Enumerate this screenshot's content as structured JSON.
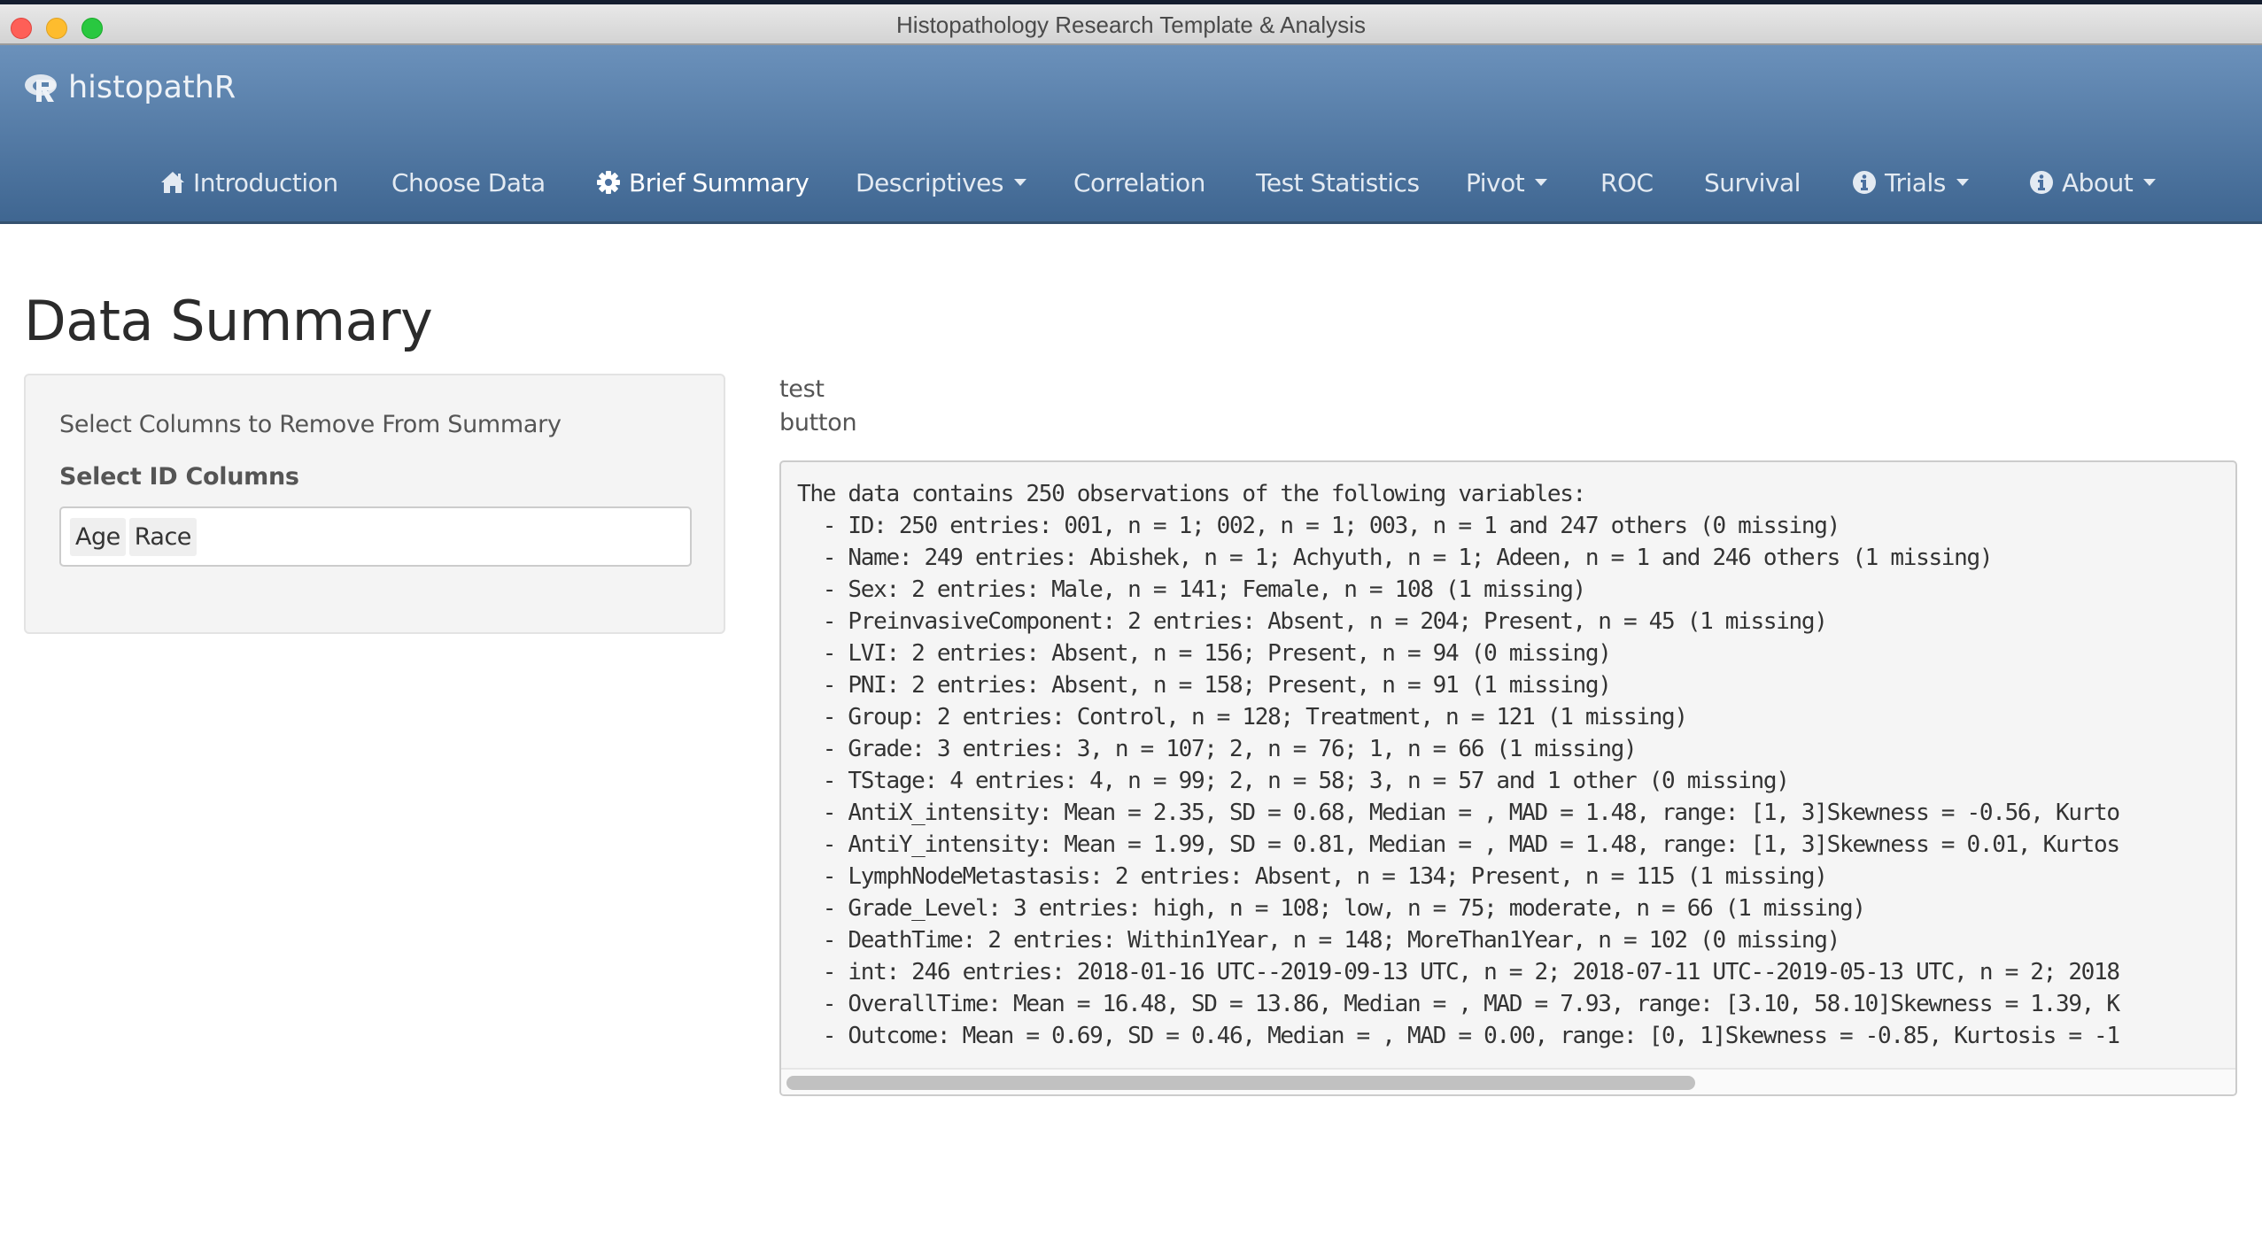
{
  "window": {
    "title": "Histopathology Research Template & Analysis",
    "controls": [
      "close",
      "minimize",
      "zoom"
    ]
  },
  "navbar": {
    "brand": {
      "icon": "r-logo-icon",
      "label": "histopathR"
    },
    "items": [
      {
        "label": "Introduction",
        "icon": "home-icon",
        "dropdown": false,
        "active": false
      },
      {
        "label": "Choose Data",
        "icon": null,
        "dropdown": false,
        "active": false
      },
      {
        "label": "Brief Summary",
        "icon": "gear-icon",
        "dropdown": false,
        "active": true
      },
      {
        "label": "Descriptives",
        "icon": null,
        "dropdown": true,
        "active": false
      },
      {
        "label": "Correlation",
        "icon": null,
        "dropdown": false,
        "active": false
      },
      {
        "label": "Test Statistics",
        "icon": null,
        "dropdown": false,
        "active": false
      },
      {
        "label": "Pivot",
        "icon": null,
        "dropdown": true,
        "active": false
      },
      {
        "label": "ROC",
        "icon": null,
        "dropdown": false,
        "active": false
      },
      {
        "label": "Survival",
        "icon": null,
        "dropdown": false,
        "active": false
      },
      {
        "label": "Trials",
        "icon": "info-circle-icon",
        "dropdown": true,
        "active": false
      },
      {
        "label": "About",
        "icon": "info-circle-icon",
        "dropdown": true,
        "active": false
      }
    ]
  },
  "page": {
    "title": "Data Summary"
  },
  "sidebar": {
    "section_label": "Select Columns to Remove From Summary",
    "id_columns": {
      "label": "Select ID Columns",
      "selected": [
        "Age",
        "Race"
      ]
    }
  },
  "main": {
    "text_lines": [
      "test",
      "button"
    ],
    "summary": {
      "lines": [
        "The data contains 250 observations of the following variables:",
        "  - ID: 250 entries: 001, n = 1; 002, n = 1; 003, n = 1 and 247 others (0 missing)",
        "  - Name: 249 entries: Abishek, n = 1; Achyuth, n = 1; Adeen, n = 1 and 246 others (1 missing)",
        "  - Sex: 2 entries: Male, n = 141; Female, n = 108 (1 missing)",
        "  - PreinvasiveComponent: 2 entries: Absent, n = 204; Present, n = 45 (1 missing)",
        "  - LVI: 2 entries: Absent, n = 156; Present, n = 94 (0 missing)",
        "  - PNI: 2 entries: Absent, n = 158; Present, n = 91 (1 missing)",
        "  - Group: 2 entries: Control, n = 128; Treatment, n = 121 (1 missing)",
        "  - Grade: 3 entries: 3, n = 107; 2, n = 76; 1, n = 66 (1 missing)",
        "  - TStage: 4 entries: 4, n = 99; 2, n = 58; 3, n = 57 and 1 other (0 missing)",
        "  - AntiX_intensity: Mean = 2.35, SD = 0.68, Median = , MAD = 1.48, range: [1, 3]Skewness = -0.56, Kurto",
        "  - AntiY_intensity: Mean = 1.99, SD = 0.81, Median = , MAD = 1.48, range: [1, 3]Skewness = 0.01, Kurtos",
        "  - LymphNodeMetastasis: 2 entries: Absent, n = 134; Present, n = 115 (1 missing)",
        "  - Grade_Level: 3 entries: high, n = 108; low, n = 75; moderate, n = 66 (1 missing)",
        "  - DeathTime: 2 entries: Within1Year, n = 148; MoreThan1Year, n = 102 (0 missing)",
        "  - int: 246 entries: 2018-01-16 UTC--2019-09-13 UTC, n = 2; 2018-07-11 UTC--2019-05-13 UTC, n = 2; 2018",
        "  - OverallTime: Mean = 16.48, SD = 13.86, Median = , MAD = 7.93, range: [3.10, 58.10]Skewness = 1.39, K",
        "  - Outcome: Mean = 0.69, SD = 0.46, Median = , MAD = 0.00, range: [0, 1]Skewness = -0.85, Kurtosis = -1"
      ],
      "horizontal_scroll_fraction_visible": 0.63
    }
  },
  "colors": {
    "navbar_top": "#6b91bb",
    "navbar_bottom": "#3f6691",
    "nav_text": "#e3eaf2",
    "well_bg": "#f4f4f4",
    "pre_bg": "#f5f5f5",
    "heading": "#2b2b2b"
  }
}
